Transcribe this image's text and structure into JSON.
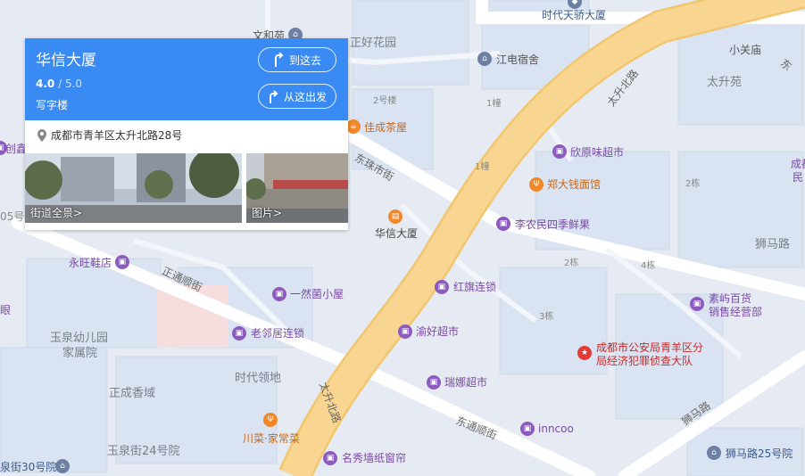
{
  "card": {
    "title": "华信大厦",
    "rating_value": "4.0",
    "rating_max": " / 5.0",
    "category": "写字楼",
    "go_here_label": "到这去",
    "from_here_label": "从这出发",
    "address": "成都市青羊区太升北路28号",
    "street_view_label": "街道全景>",
    "photos_label": "图片>"
  },
  "labels": {
    "wenhe": "文和苑",
    "zhenghao": "正好花园",
    "shidai_tianjiao": "时代天骄大厦",
    "xiaoguanmiao": "小关庙",
    "dong_corner": "东",
    "jiangdian": "江电宿舍",
    "taishengyuan": "太升苑",
    "building2": "2号楼",
    "building1a": "1幢",
    "building1b": "1幢",
    "jiacheng": "佳成茶屋",
    "chuangxin": "创鑫",
    "xinyuanwei": "欣原味超市",
    "chengdu_right": "成都",
    "min_right": "民",
    "zhengda": "郑大钱面馆",
    "unit2a": "2栋",
    "huaxin": "华信大厦",
    "linong": "李农民四季鲜果",
    "haolu": "05号",
    "yongwang": "永旺鞋店",
    "shimalu": "狮马路",
    "unit2b": "2栋",
    "unit4": "4栋",
    "yiran": "一然菌小屋",
    "hongqi": "红旗连锁",
    "sulin": "素屿百货",
    "sulin2": "销售经营部",
    "yan": "眼",
    "unit3": "3栋",
    "yuquan": "玉泉幼儿园",
    "jiashuyuan": "家属院",
    "laolinju": "老邻居连锁",
    "yuhao": "渝好超市",
    "police1": "成都市公安局青羊区分",
    "police2": "局经济犯罪侦查大队",
    "zhengcheng": "正成香域",
    "shidai_lingdi": "时代领地",
    "ruina": "瑞娜超市",
    "chuancai": "川菜·家常菜",
    "inncoo": "inncoo",
    "yuquan24": "玉泉街24号院",
    "mingxiu": "名秀墙纸窗帘",
    "yuquan30": "泉街30号院",
    "shimalu25": "狮马路25号院"
  },
  "roads": {
    "taishengbei_top": "太升北路",
    "taishengbei_bottom": "太升北路",
    "dongzhu": "东珠市街",
    "zhengtong": "正通顺街",
    "dongtong": "东通顺街",
    "shimalu_road": "狮马路",
    "dongfang": "东方"
  },
  "colors": {
    "accent": "#3a8af3",
    "main_road": "#f7d48d",
    "poi_purple": "#8d5ac0",
    "poi_orange": "#f0882a",
    "poi_red": "#e53935"
  }
}
